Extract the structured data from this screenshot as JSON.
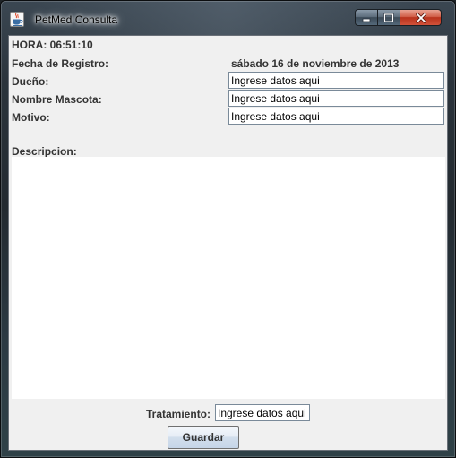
{
  "window": {
    "title": "PetMed Consulta",
    "controls": {
      "minimize_icon": "minimize-icon",
      "maximize_icon": "maximize-icon",
      "close_icon": "close-icon"
    },
    "app_icon": "java-coffee-cup-icon"
  },
  "form": {
    "time_label": "HORA: 06:51:10",
    "date_label": "Fecha de Registro:",
    "date_value": "sábado 16 de noviembre de 2013",
    "owner_label": "Dueño:",
    "owner_value": "Ingrese datos aqui",
    "pet_name_label": "Nombre Mascota:",
    "pet_name_value": "Ingrese datos aqui",
    "reason_label": "Motivo:",
    "reason_value": "Ingrese datos aqui",
    "description_label": "Descripcion:",
    "description_value": "",
    "treatment_label": "Tratamiento:",
    "treatment_value": "Ingrese datos aqui",
    "save_label": "Guardar"
  },
  "colors": {
    "client_background": "#f0f0f0",
    "label_text": "#333333",
    "close_button": "#c7402b"
  }
}
